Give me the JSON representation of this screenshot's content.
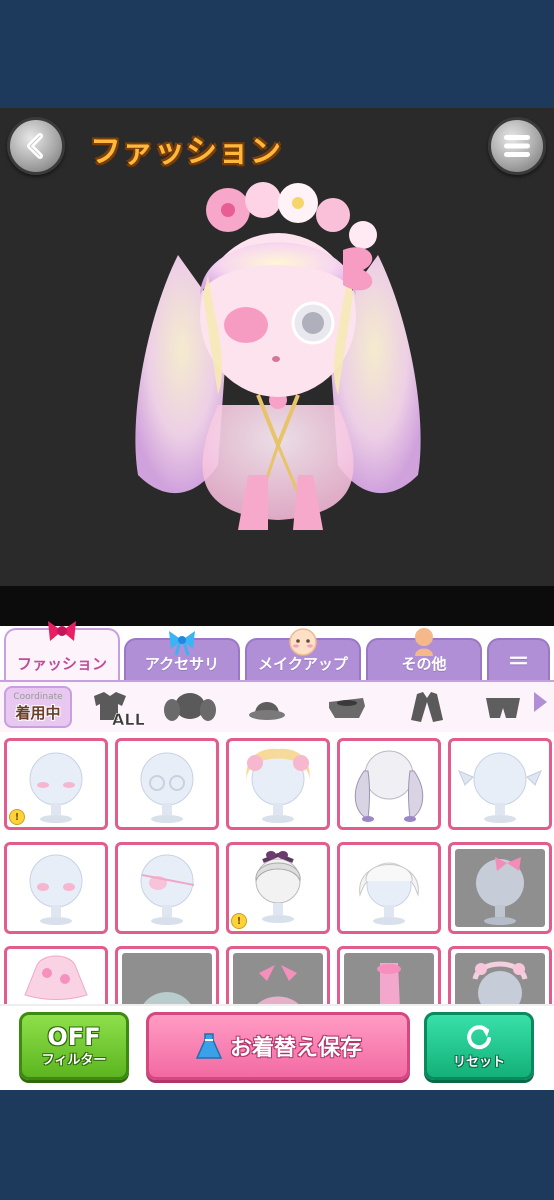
{
  "header": {
    "title": "ファッション",
    "back_icon": "chevron-left-icon",
    "menu_icon": "hamburger-menu-icon"
  },
  "tabs": [
    {
      "label": "ファッション",
      "icon": "bow-icon",
      "active": true
    },
    {
      "label": "アクセサリ",
      "icon": "ribbon-icon",
      "active": false
    },
    {
      "label": "メイクアップ",
      "icon": "face-icon",
      "active": false
    },
    {
      "label": "その他",
      "icon": "silhouette-icon",
      "active": false
    },
    {
      "label": "＝",
      "icon": "more-icon",
      "active": false
    }
  ],
  "subcategories": {
    "wearing_top": "Coordinate",
    "wearing_label": "着用中",
    "all_label": "ALL",
    "items": [
      "all-clothes-icon",
      "hair-icon",
      "hat-icon",
      "shoes-icon",
      "coat-icon",
      "bottoms-icon"
    ]
  },
  "grid": {
    "rows": [
      [
        {
          "kind": "face-blush-item",
          "dark": false,
          "hint": true
        },
        {
          "kind": "glasses-item",
          "dark": false,
          "hint": false
        },
        {
          "kind": "curly-hair-item",
          "dark": false,
          "hint": false
        },
        {
          "kind": "twintail-hair-item",
          "dark": false,
          "hint": false
        },
        {
          "kind": "wing-ear-item",
          "dark": false,
          "hint": false
        }
      ],
      [
        {
          "kind": "blush-item",
          "dark": false,
          "hint": false
        },
        {
          "kind": "eyepatch-item",
          "dark": false,
          "hint": false
        },
        {
          "kind": "headband-hair-item",
          "dark": false,
          "hint": true
        },
        {
          "kind": "bob-hair-item",
          "dark": false,
          "hint": false
        },
        {
          "kind": "hair-clip-item",
          "dark": true,
          "hint": false
        }
      ],
      [
        {
          "kind": "dress-item",
          "dark": false,
          "hint": false
        },
        {
          "kind": "dark-outfit-item",
          "dark": true,
          "hint": false
        },
        {
          "kind": "bow-dress-item",
          "dark": true,
          "hint": false
        },
        {
          "kind": "shoes-item",
          "dark": true,
          "hint": false
        },
        {
          "kind": "headpiece-item",
          "dark": true,
          "hint": false
        }
      ]
    ],
    "hint_symbol": "!"
  },
  "buttons": {
    "filter_top": "OFF",
    "filter_bottom": "フィルター",
    "save_label": "お着替え保存",
    "save_icon": "dress-icon",
    "reset_label": "リセット",
    "reset_icon": "refresh-icon"
  },
  "colors": {
    "stage_bg": "#2a2a2a",
    "band_bg": "#1d3a5c",
    "title_fill": "#ffb93a",
    "cell_border": "#e25c8c",
    "tab_inactive": "#b08fd6",
    "save_button": "#f26aa2",
    "filter_button": "#5cb520",
    "reset_button": "#14b07a"
  }
}
